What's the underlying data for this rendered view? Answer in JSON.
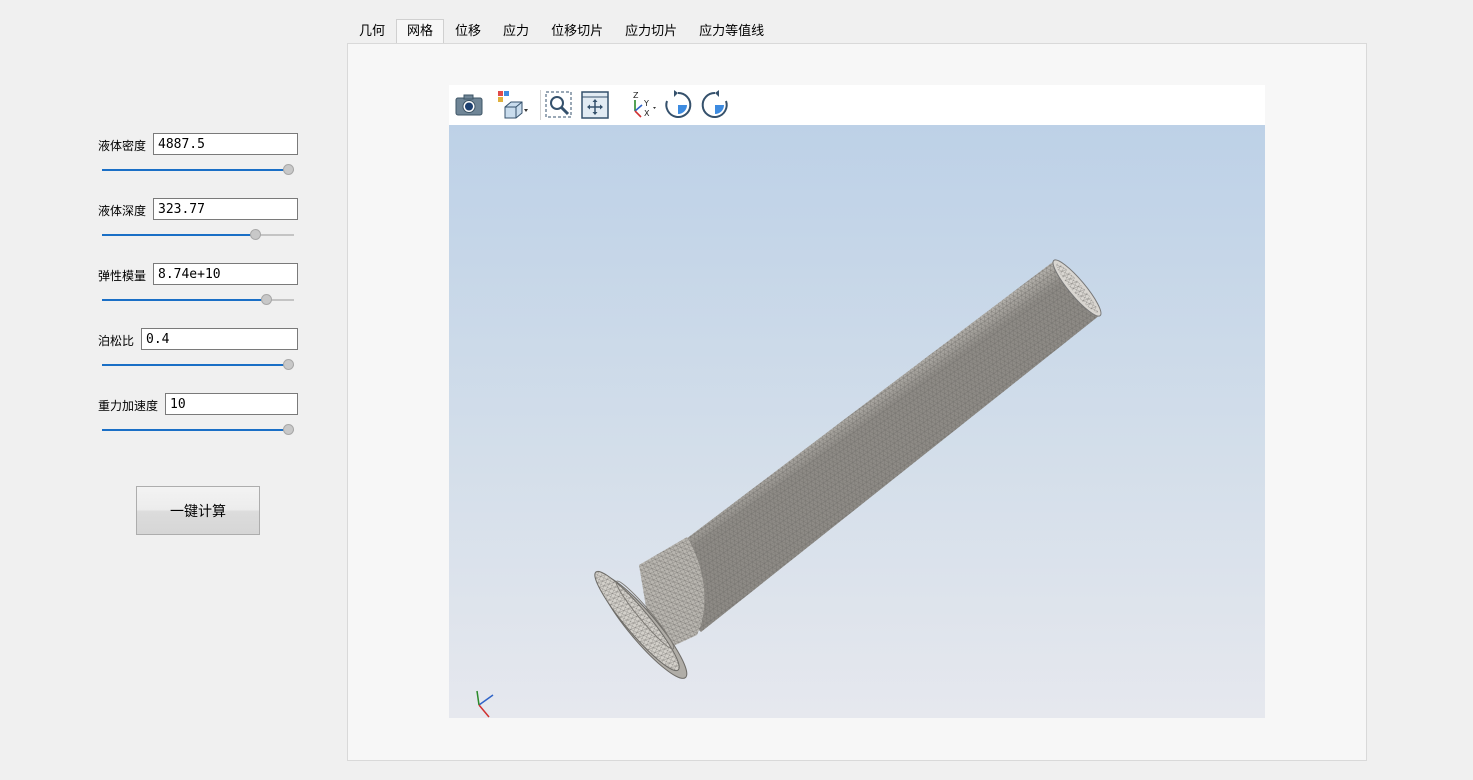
{
  "params": [
    {
      "label": "液体密度",
      "value": "4887.5",
      "slider_fraction": 1.0
    },
    {
      "label": "液体深度",
      "value": "323.77",
      "slider_fraction": 0.82
    },
    {
      "label": "弹性模量",
      "value": "8.74e+10",
      "slider_fraction": 0.88
    },
    {
      "label": "泊松比",
      "value": "0.4",
      "slider_fraction": 1.0
    },
    {
      "label": "重力加速度",
      "value": "10",
      "slider_fraction": 1.0
    }
  ],
  "calc_button": "一键计算",
  "tabs": [
    "几何",
    "网格",
    "位移",
    "应力",
    "位移切片",
    "应力切片",
    "应力等值线"
  ],
  "active_tab": "网格",
  "toolbar_icons": [
    "camera-icon",
    "view-cube-icon",
    "zoom-box-icon",
    "fit-all-icon",
    "axes-triad-icon",
    "rotate-cw-icon",
    "rotate-ccw-icon"
  ],
  "axis_labels": {
    "z": "Z",
    "y": "Y",
    "x": "X"
  },
  "colors": {
    "accent": "#1a6fc6",
    "background_top": "#bdd1e7",
    "background_bottom": "#e6e8ee",
    "mesh": "#c9c6c0"
  }
}
